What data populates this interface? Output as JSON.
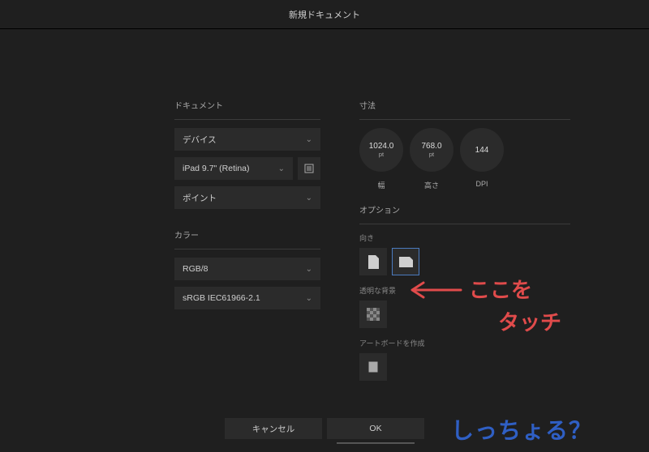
{
  "header": {
    "title": "新規ドキュメント"
  },
  "left": {
    "doc_label": "ドキュメント",
    "type_label": "デバイス",
    "device_label": "iPad 9.7\" (Retina)",
    "unit_label": "ポイント",
    "color_section": "カラー",
    "color_format": "RGB/8",
    "color_profile": "sRGB IEC61966-2.1"
  },
  "right": {
    "dim_label": "寸法",
    "width_val": "1024.0",
    "height_val": "768.0",
    "dpi_val": "144",
    "unit_pt": "pt",
    "width_lbl": "幅",
    "height_lbl": "高さ",
    "dpi_lbl": "DPI",
    "options_label": "オプション",
    "orientation_label": "向き",
    "transparent_bg_label": "透明な背景",
    "artboard_label": "アートボードを作成"
  },
  "footer": {
    "cancel": "キャンセル",
    "ok": "OK"
  },
  "annotation": {
    "arrow_text1": "ここを",
    "arrow_text2": "タッチ",
    "watermark": "しっちょる？"
  }
}
